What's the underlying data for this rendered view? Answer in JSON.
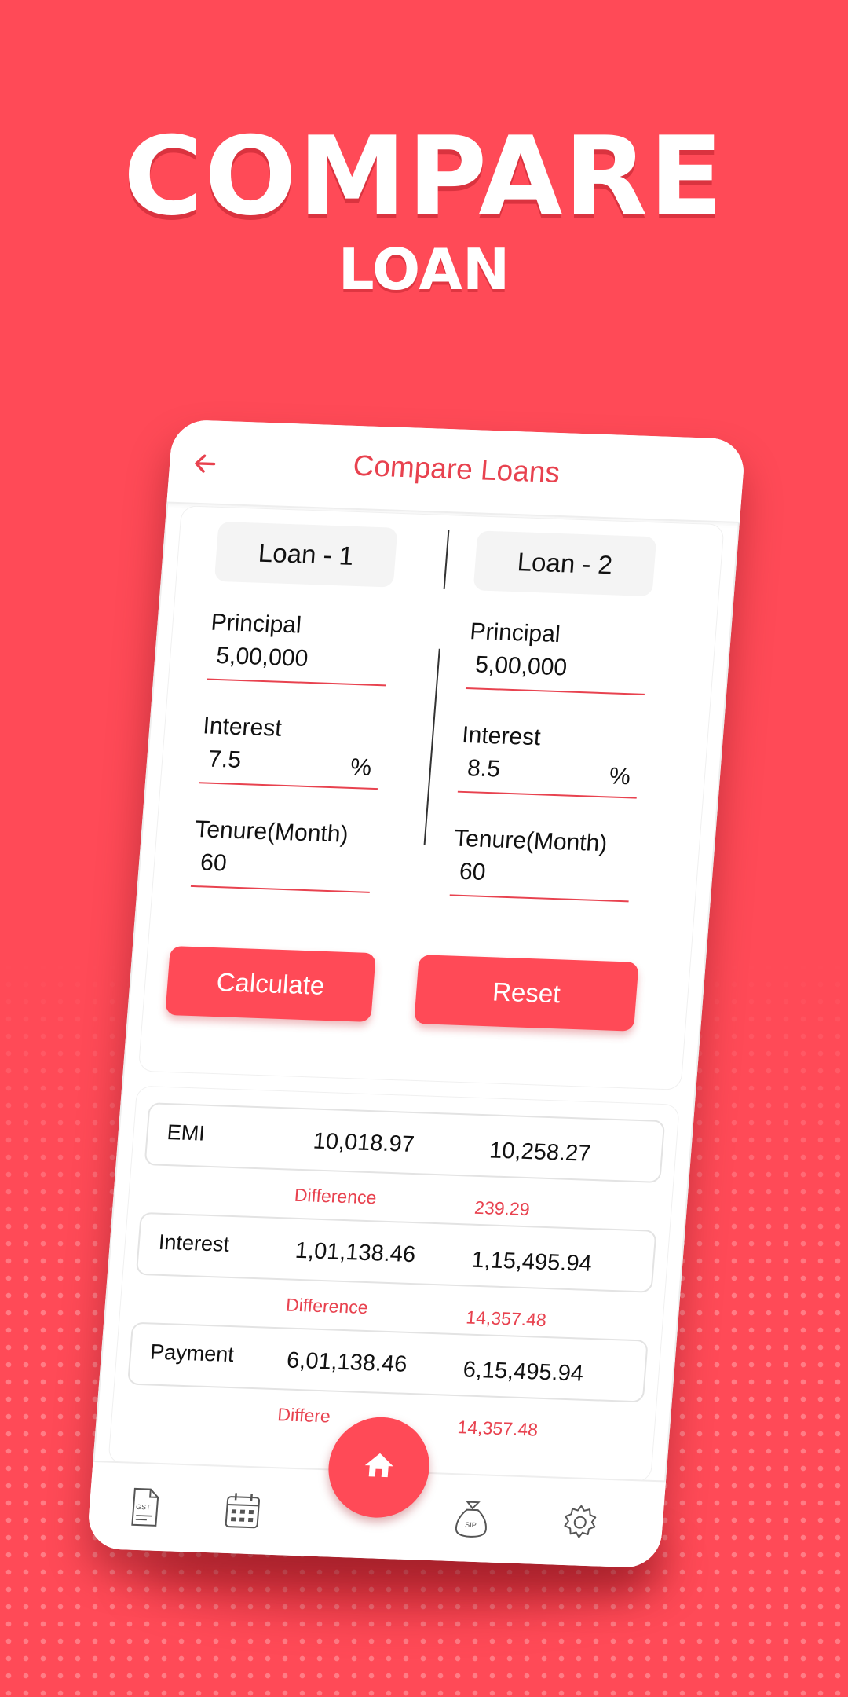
{
  "headline": {
    "big": "COMPARE",
    "small": "LOAN"
  },
  "app": {
    "title": "Compare Loans",
    "loans": [
      {
        "tab": "Loan - 1",
        "principal_label": "Principal",
        "principal": "5,00,000",
        "interest_label": "Interest",
        "interest": "7.5",
        "percent": "%",
        "tenure_label": "Tenure(Month)",
        "tenure": "60"
      },
      {
        "tab": "Loan - 2",
        "principal_label": "Principal",
        "principal": "5,00,000",
        "interest_label": "Interest",
        "interest": "8.5",
        "percent": "%",
        "tenure_label": "Tenure(Month)",
        "tenure": "60"
      }
    ],
    "buttons": {
      "calculate": "Calculate",
      "reset": "Reset"
    },
    "results": [
      {
        "name": "EMI",
        "loan1": "10,018.97",
        "loan2": "10,258.27",
        "diff_label": "Difference",
        "diff": "239.29"
      },
      {
        "name": "Interest",
        "loan1": "1,01,138.46",
        "loan2": "1,15,495.94",
        "diff_label": "Difference",
        "diff": "14,357.48"
      },
      {
        "name": "Payment",
        "loan1": "6,01,138.46",
        "loan2": "6,15,495.94",
        "diff_label": "Differe",
        "diff": "14,357.48"
      }
    ],
    "nav": {
      "gst_text": "GST",
      "sip_text": "SIP",
      "items": [
        "gst-icon",
        "calendar-icon",
        "home-icon",
        "sip-icon",
        "settings-icon"
      ]
    },
    "colors": {
      "accent": "#ff4a57",
      "accent_text": "#e8424f"
    }
  }
}
